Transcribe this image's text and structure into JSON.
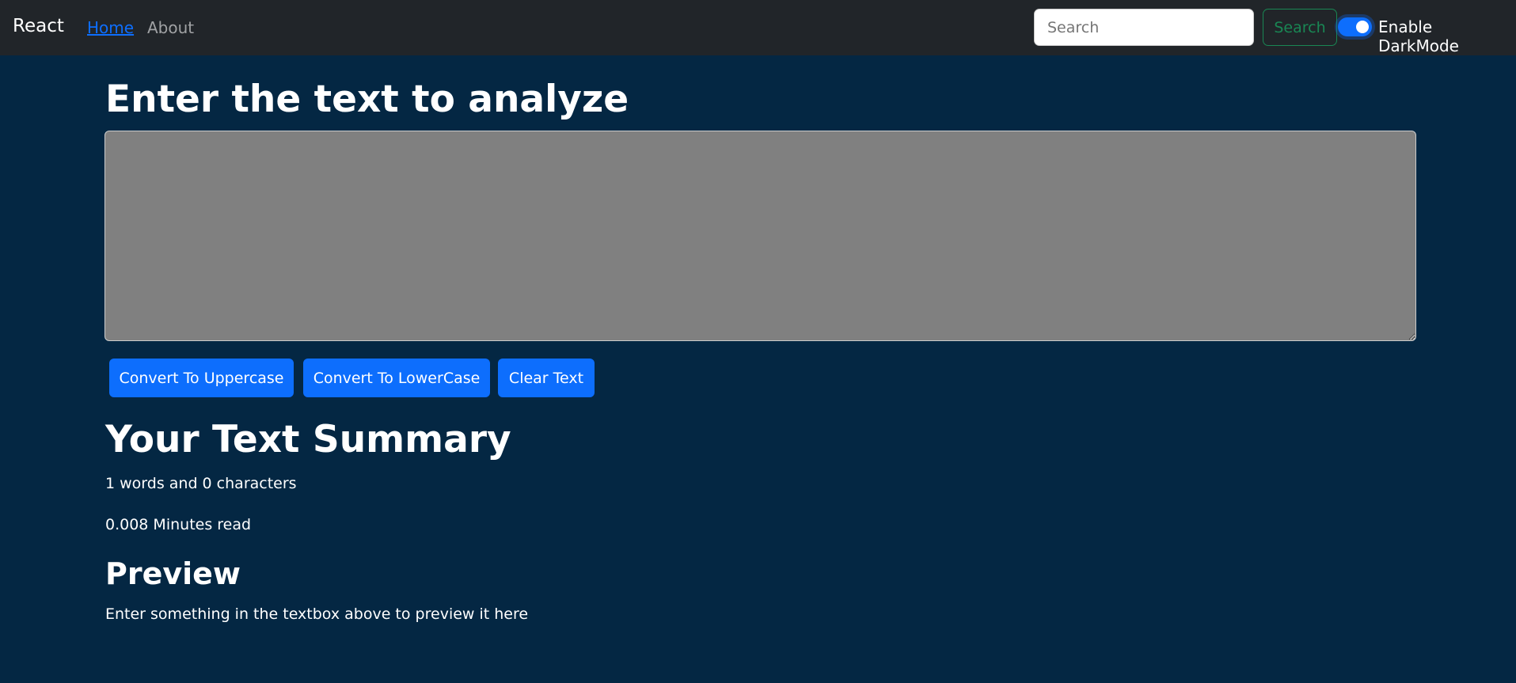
{
  "navbar": {
    "brand": "React",
    "links": [
      {
        "label": "Home",
        "active": true
      },
      {
        "label": "About",
        "active": false
      }
    ],
    "search_placeholder": "Search",
    "search_button": "Search",
    "darkmode_label": "Enable DarkMode",
    "darkmode_enabled": true
  },
  "main": {
    "heading": "Enter the text to analyze",
    "textarea_value": "",
    "buttons": [
      "Convert To Uppercase",
      "Convert To LowerCase",
      "Clear Text"
    ],
    "summary_heading": "Your Text Summary",
    "word_count_text": "1 words and 0 characters",
    "read_time_text": "0.008 Minutes read",
    "preview_heading": "Preview",
    "preview_text": "Enter something in the textbox above to preview it here"
  },
  "colors": {
    "navbar": "#212529",
    "background": "#042743",
    "primary": "#0d6efd",
    "success": "#198754",
    "textarea": "#808080"
  }
}
